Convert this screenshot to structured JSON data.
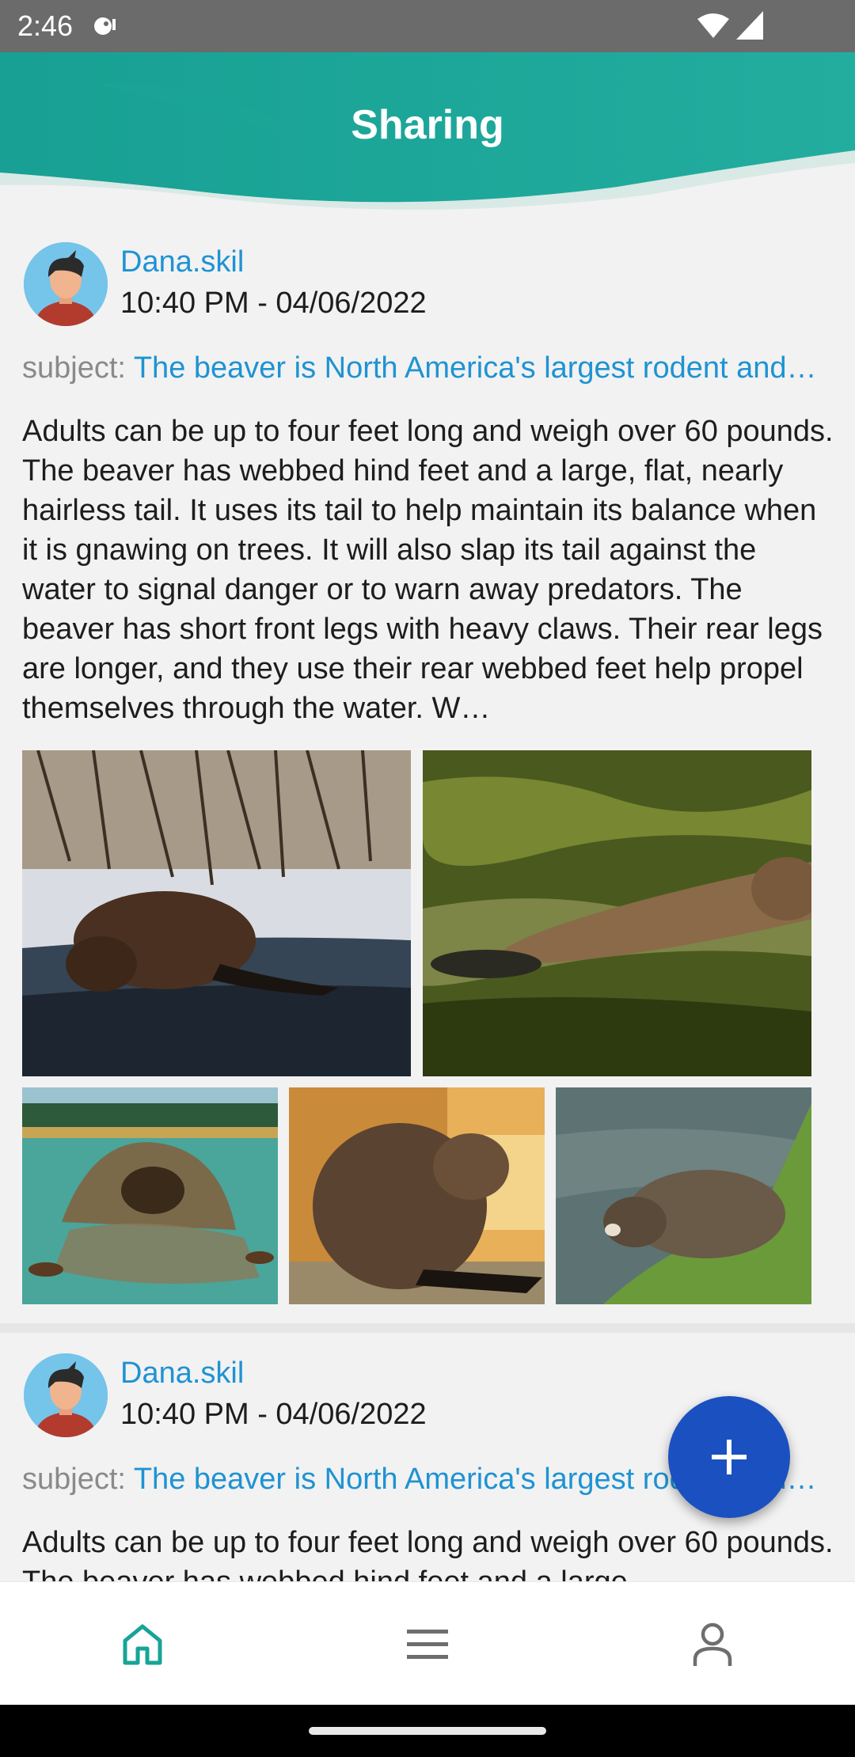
{
  "status_bar": {
    "time": "2:46"
  },
  "header": {
    "title": "Sharing"
  },
  "posts": [
    {
      "username": "Dana.skil",
      "timestamp": "10:40 PM - 04/06/2022",
      "subject_prefix": "subject: ",
      "subject": "The beaver is North America's largest rodent and…",
      "body": "Adults can be up to four feet long and weigh over 60 pounds. The beaver has webbed hind feet and a large, flat, nearly hairless tail. It uses its tail to help maintain its balance when it is gnawing on trees. It will also slap its tail against the water to signal danger or to warn away predators. The beaver has short front legs with heavy claws. Their rear legs are longer, and they use their rear webbed feet help propel themselves through the water. W…"
    },
    {
      "username": "Dana.skil",
      "timestamp": "10:40 PM - 04/06/2022",
      "subject_prefix": "subject: ",
      "subject": "The beaver is North America's largest rodent and…",
      "body": "Adults can be up to four feet long and weigh over 60 pounds. The beaver has webbed hind feet and a large,"
    }
  ],
  "bottom_nav": {
    "items": [
      {
        "icon": "home-icon",
        "active": true
      },
      {
        "icon": "menu-icon",
        "active": false
      },
      {
        "icon": "profile-icon",
        "active": false
      }
    ]
  },
  "colors": {
    "header_teal": "#1ea99b",
    "link_blue": "#1e93d3",
    "fab_blue": "#1b50c0",
    "active_nav": "#17a497",
    "inactive_nav": "#6e6e6e"
  }
}
